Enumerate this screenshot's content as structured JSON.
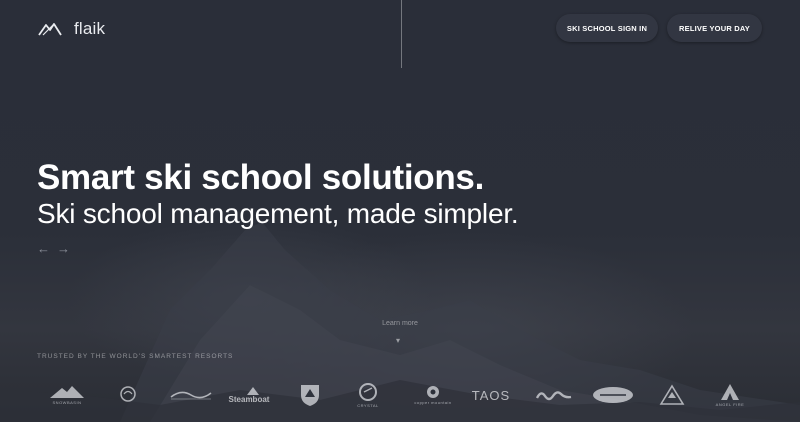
{
  "header": {
    "brand": "flaik",
    "nav": [
      {
        "label": "SKI SCHOOL SIGN IN"
      },
      {
        "label": "RELIVE YOUR DAY"
      }
    ]
  },
  "hero": {
    "headline": "Smart ski school solutions.",
    "subheadline": "Ski school management, made simpler.",
    "prev_arrow": "←",
    "next_arrow": "→",
    "learn_more": "Learn more",
    "learn_more_chevron": "▾"
  },
  "trusted": {
    "label": "TRUSTED BY THE WORLD'S SMARTEST RESORTS",
    "resorts": [
      {
        "name": "SNOWBASIN",
        "icon": "snowbasin-logo"
      },
      {
        "name": "",
        "icon": "helmet-logo"
      },
      {
        "name": "",
        "icon": "swoosh-logo"
      },
      {
        "name": "Steamboat",
        "icon": "steamboat-logo"
      },
      {
        "name": "",
        "icon": "shield-logo"
      },
      {
        "name": "CRYSTAL",
        "icon": "crystal-logo"
      },
      {
        "name": "copper mountain",
        "icon": "copper-logo"
      },
      {
        "name": "TAOS",
        "icon": "taos-logo"
      },
      {
        "name": "",
        "icon": "script-logo"
      },
      {
        "name": "",
        "icon": "oval-logo"
      },
      {
        "name": "",
        "icon": "peak-logo"
      },
      {
        "name": "ANGEL FIRE",
        "icon": "angel-fire-logo"
      }
    ]
  }
}
